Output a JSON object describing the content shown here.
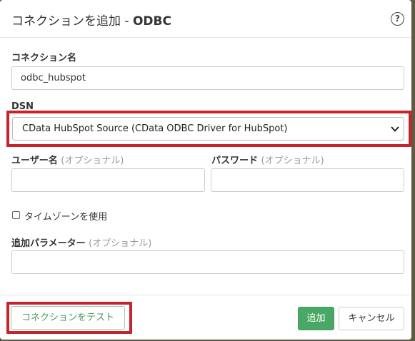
{
  "dialog": {
    "title": "コネクションを追加 -",
    "title_sub": "ODBC",
    "help_icon": "?"
  },
  "form": {
    "connection_name": {
      "label": "コネクション名",
      "value": "odbc_hubspot"
    },
    "dsn": {
      "label": "DSN",
      "selected": "CData HubSpot Source (CData ODBC Driver for HubSpot)"
    },
    "username": {
      "label": "ユーザー名",
      "optional": "(オプショナル)",
      "value": ""
    },
    "password": {
      "label": "パスワード",
      "optional": "(オプショナル)",
      "value": ""
    },
    "timezone": {
      "label": "タイムゾーンを使用",
      "checked": false
    },
    "extra_params": {
      "label": "追加パラメーター",
      "optional": "(オプショナル)",
      "value": ""
    }
  },
  "footer": {
    "test_label": "コネクションをテスト",
    "add_label": "追加",
    "cancel_label": "キャンセル"
  },
  "colors": {
    "highlight": "#c8232c",
    "primary_green": "#4aa866"
  }
}
